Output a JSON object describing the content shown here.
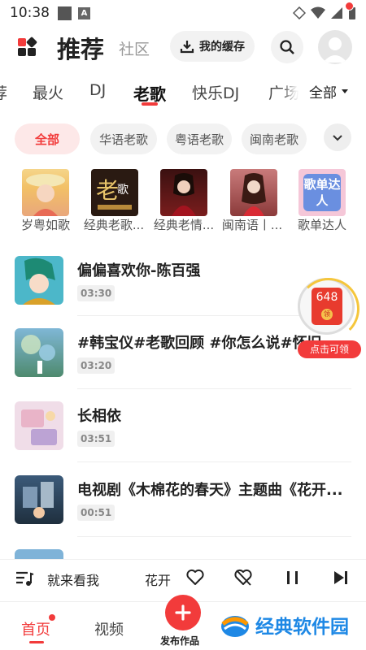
{
  "status": {
    "time": "10:38"
  },
  "header": {
    "title": "推荐",
    "community": "社区",
    "cache_label": "我的缓存"
  },
  "categories": {
    "items": [
      "荐",
      "最火",
      "DJ",
      "老歌",
      "快乐DJ",
      "广场"
    ],
    "active": "老歌",
    "all_label": "全部"
  },
  "filters": [
    "全部",
    "华语老歌",
    "粤语老歌",
    "闽南老歌"
  ],
  "playlists": [
    {
      "label": "岁粤如歌"
    },
    {
      "label": "经典老歌..."
    },
    {
      "label": "经典老情..."
    },
    {
      "label": "闽南语丨..."
    },
    {
      "label": "歌单达人",
      "cover_text": "歌单达人"
    }
  ],
  "songs": [
    {
      "title": "偏偏喜欢你-陈百强",
      "duration": "03:30"
    },
    {
      "title": "#韩宝仪#老歌回顾 #你怎么说#怀旧",
      "duration": "03:20"
    },
    {
      "title": "长相依",
      "duration": "03:51"
    },
    {
      "title": "电视剧《木棉花的春天》主题曲《花开...",
      "duration": "00:51"
    }
  ],
  "red_packet": {
    "amount": "648",
    "coin": "领",
    "label": "点击可领"
  },
  "player": {
    "text1": "就来看我",
    "text2": "花开"
  },
  "nav": {
    "home": "首页",
    "video": "视频",
    "publish": "发布作品"
  },
  "watermark": {
    "text": "经典软件园"
  },
  "colors": {
    "accent": "#f23b3b",
    "watermark": "#1e88e5"
  }
}
